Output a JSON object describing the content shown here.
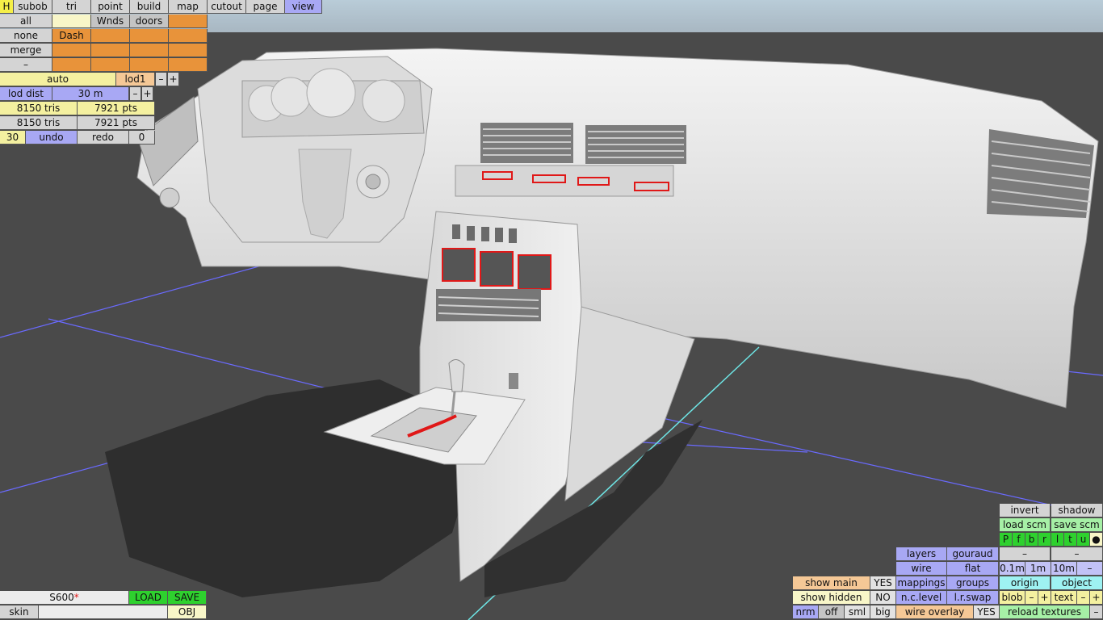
{
  "menu": {
    "h": "H",
    "tabs": [
      "subob",
      "tri",
      "point",
      "build",
      "map",
      "cutout",
      "page",
      "view"
    ],
    "active_tab": "view"
  },
  "subobj": {
    "all": "all",
    "none": "none",
    "merge": "merge",
    "minus": "–",
    "cells": [
      "",
      "Wnds",
      "doors",
      "Dash"
    ]
  },
  "lod": {
    "auto": "auto",
    "level": "lod1",
    "minus": "–",
    "plus": "+",
    "dist_label": "lod dist",
    "dist_value": "30 m",
    "tris_1": "8150 tris",
    "pts_1": "7921 pts",
    "tris_2": "8150 tris",
    "pts_2": "7921 pts"
  },
  "history": {
    "count": "30",
    "undo": "undo",
    "redo": "redo",
    "redo_count": "0"
  },
  "file": {
    "name": "S600",
    "modified": "*",
    "load": "LOAD",
    "save": "SAVE",
    "skin": "skin",
    "obj": "OBJ"
  },
  "view_panel": {
    "invert": "invert",
    "shadow": "shadow",
    "load_scm": "load scm",
    "save_scm": "save scm",
    "flags": [
      "P",
      "f",
      "b",
      "r",
      "l",
      "t",
      "u",
      "●"
    ],
    "layers": "layers",
    "gouraud": "gouraud",
    "dash": "–",
    "wire": "wire",
    "flat": "flat",
    "scales": [
      "0.1m",
      "1m",
      "10m",
      "–"
    ],
    "show_main": "show main",
    "show_main_val": "YES",
    "mappings": "mappings",
    "groups": "groups",
    "origin": "origin",
    "object": "object",
    "show_hidden": "show hidden",
    "show_hidden_val": "NO",
    "nc_level": "n.c.level",
    "lr_swap": "l.r.swap",
    "blob": "blob",
    "text": "text",
    "minus": "–",
    "plus": "+",
    "nrm": "nrm",
    "off": "off",
    "sml": "sml",
    "big": "big",
    "wire_overlay": "wire overlay",
    "wire_overlay_val": "YES",
    "reload_textures": "reload textures"
  }
}
